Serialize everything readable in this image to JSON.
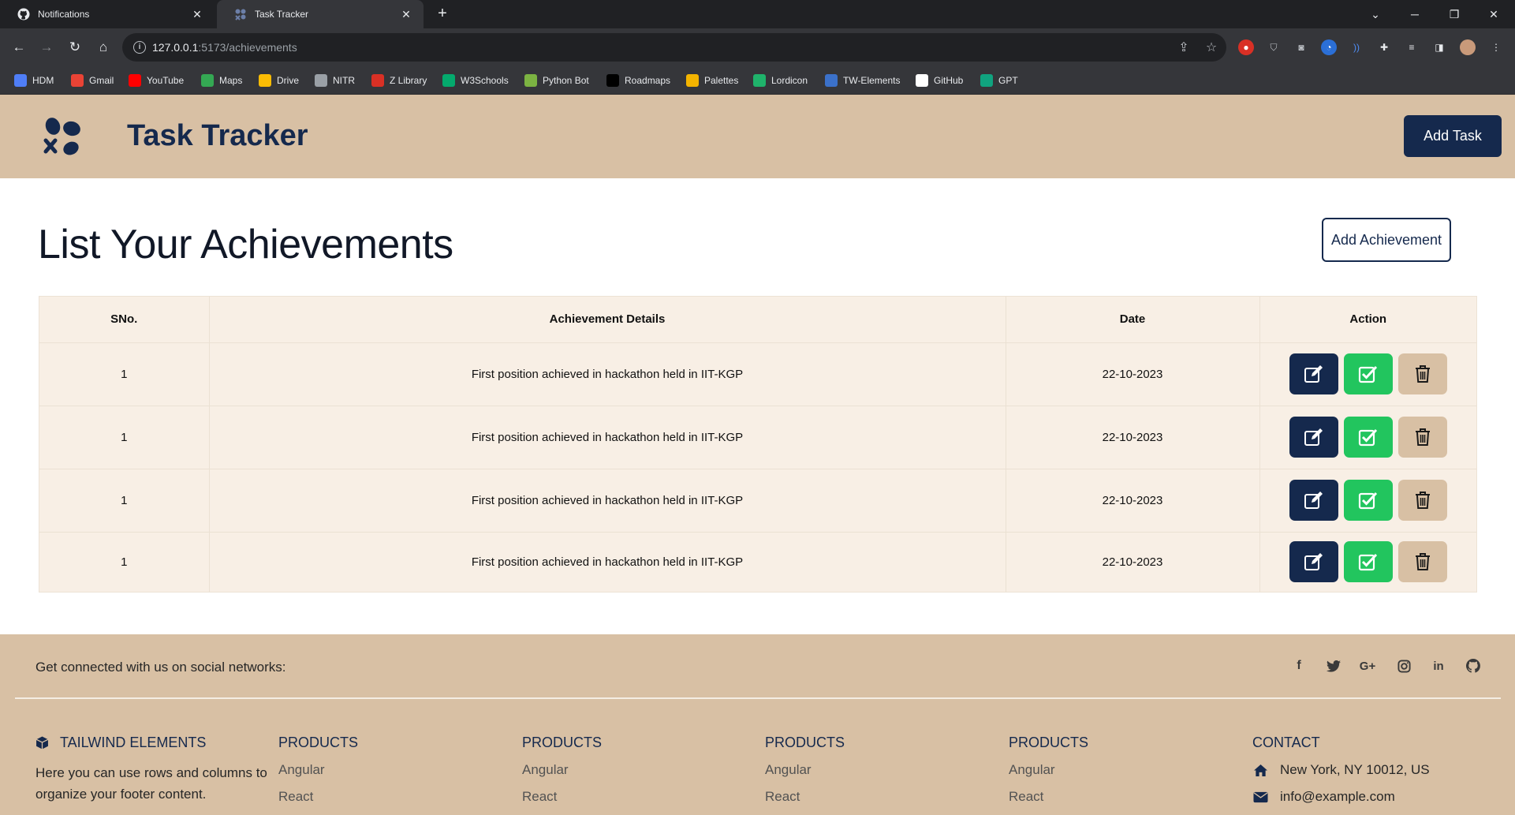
{
  "browser": {
    "tabs": [
      {
        "label": "Notifications",
        "icon": "github-icon",
        "active": false
      },
      {
        "label": "Task Tracker",
        "icon": "task-tracker-icon",
        "active": true
      }
    ],
    "url_host": "127.0.0.1",
    "url_path": ":5173/achievements",
    "bookmarks": [
      {
        "label": "HDM",
        "icon": "hdm-icon",
        "color": "#4f7ef7"
      },
      {
        "label": "Gmail",
        "icon": "gmail-icon",
        "color": "#ea4335"
      },
      {
        "label": "YouTube",
        "icon": "youtube-icon",
        "color": "#ff0000"
      },
      {
        "label": "Maps",
        "icon": "maps-icon",
        "color": "#34a853"
      },
      {
        "label": "Drive",
        "icon": "drive-icon",
        "color": "#fbbc04"
      },
      {
        "label": "NITR",
        "icon": "nitr-icon",
        "color": "#9aa0a6"
      },
      {
        "label": "Z Library",
        "icon": "z-library-icon",
        "color": "#d93025"
      },
      {
        "label": "W3Schools",
        "icon": "w3schools-icon",
        "color": "#04aa6d"
      },
      {
        "label": "Python Bot",
        "icon": "python-bot-icon",
        "color": "#7cb342"
      },
      {
        "label": "Roadmaps",
        "icon": "roadmaps-icon",
        "color": "#000000"
      },
      {
        "label": "Palettes",
        "icon": "palettes-icon",
        "color": "#f4b400"
      },
      {
        "label": "Lordicon",
        "icon": "lordicon-icon",
        "color": "#1fb36b"
      },
      {
        "label": "TW-Elements",
        "icon": "tw-elements-icon",
        "color": "#3b71ca"
      },
      {
        "label": "GitHub",
        "icon": "github-icon",
        "color": "#ffffff"
      },
      {
        "label": "GPT",
        "icon": "gpt-icon",
        "color": "#10a37f"
      }
    ]
  },
  "navbar": {
    "title": "Task Tracker",
    "add_task_label": "Add Task"
  },
  "main": {
    "heading": "List Your Achievements",
    "add_achievement_label": "Add Achievement"
  },
  "table": {
    "headers": [
      "SNo.",
      "Achievement Details",
      "Date",
      "Action"
    ],
    "rows": [
      {
        "sno": "1",
        "details": "First position achieved in hackathon held in IIT-KGP",
        "date": "22-10-2023"
      },
      {
        "sno": "1",
        "details": "First position achieved in hackathon held in IIT-KGP",
        "date": "22-10-2023"
      },
      {
        "sno": "1",
        "details": "First position achieved in hackathon held in IIT-KGP",
        "date": "22-10-2023"
      },
      {
        "sno": "1",
        "details": "First position achieved in hackathon held in IIT-KGP",
        "date": "22-10-2023"
      }
    ]
  },
  "footer": {
    "social_text": "Get connected with us on social networks:",
    "social_icons": [
      "facebook-icon",
      "twitter-icon",
      "google-plus-icon",
      "instagram-icon",
      "linkedin-icon",
      "github-icon"
    ],
    "brand": {
      "title": "TAILWIND ELEMENTS",
      "description": "Here you can use rows and columns to organize your footer content."
    },
    "product_columns": [
      {
        "title": "PRODUCTS",
        "links": [
          "Angular",
          "React"
        ]
      },
      {
        "title": "PRODUCTS",
        "links": [
          "Angular",
          "React"
        ]
      },
      {
        "title": "PRODUCTS",
        "links": [
          "Angular",
          "React"
        ]
      },
      {
        "title": "PRODUCTS",
        "links": [
          "Angular",
          "React"
        ]
      }
    ],
    "contact": {
      "title": "CONTACT",
      "address": "New York, NY 10012, US",
      "email": "info@example.com"
    }
  },
  "colors": {
    "navy": "#15294d",
    "tan": "#d8c0a4",
    "green": "#22c55e",
    "table_bg": "#f8efe5"
  }
}
